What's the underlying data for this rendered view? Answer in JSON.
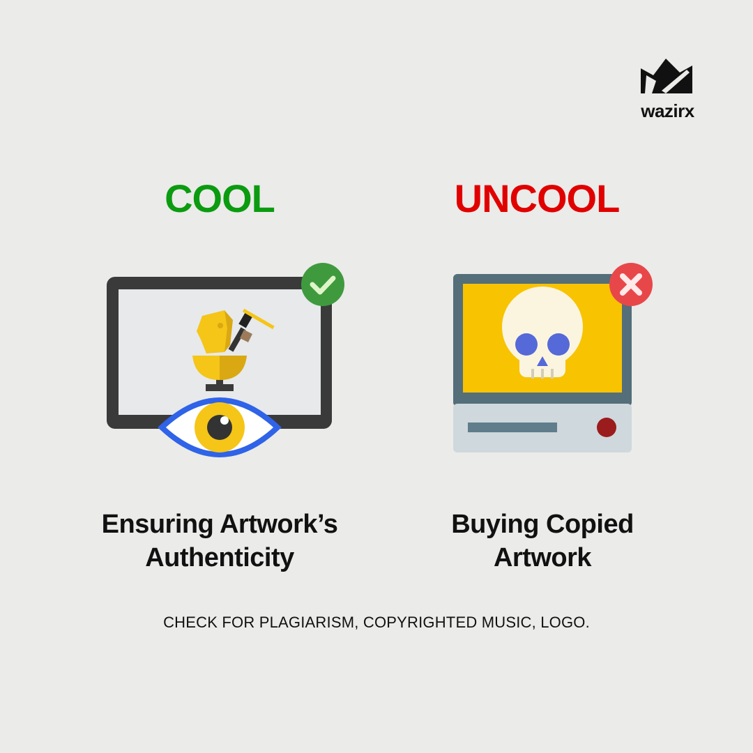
{
  "brand": {
    "name": "wazirx"
  },
  "left": {
    "heading": "COOL",
    "heading_color": "#0b9b10",
    "caption_line1": "Ensuring Artwork’s",
    "caption_line2": "Authenticity",
    "badge_icon": "checkmark-icon",
    "badge_color": "#3f9a3e"
  },
  "right": {
    "heading": "UNCOOL",
    "heading_color": "#e00000",
    "caption_line1": "Buying Copied",
    "caption_line2": "Artwork",
    "badge_icon": "cross-icon",
    "badge_color": "#e8474a"
  },
  "footnote": "CHECK FOR PLAGIARISM, COPYRIGHTED MUSIC, LOGO."
}
